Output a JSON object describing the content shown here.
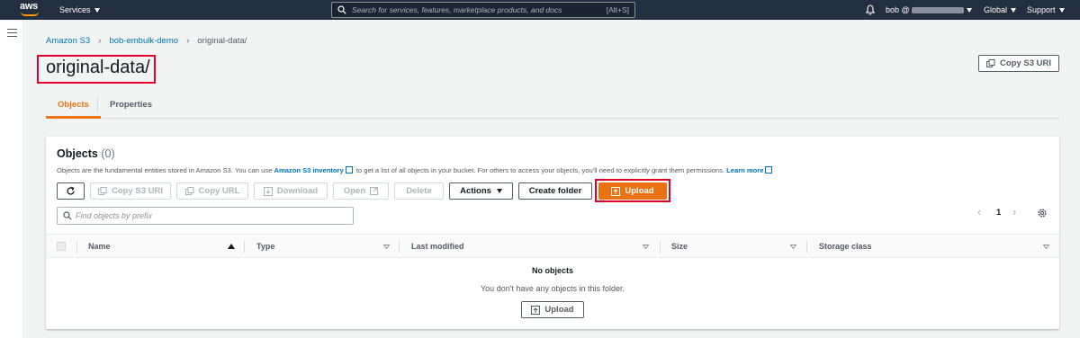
{
  "topnav": {
    "logo_text": "aws",
    "services_label": "Services",
    "search_placeholder": "Search for services, features, marketplace products, and docs",
    "search_shortcut": "[Alt+S]",
    "user_label": "bob @",
    "region_label": "Global",
    "support_label": "Support"
  },
  "breadcrumb": {
    "items": [
      "Amazon S3",
      "bob-embulk-demo",
      "original-data/"
    ]
  },
  "page": {
    "title": "original-data/",
    "copy_uri_label": "Copy S3 URI"
  },
  "tabs": [
    {
      "label": "Objects",
      "active": true
    },
    {
      "label": "Properties",
      "active": false
    }
  ],
  "objects_panel": {
    "title": "Objects",
    "count": "(0)",
    "desc_before": "Objects are the fundamental entities stored in Amazon S3. You can use ",
    "desc_link": "Amazon S3 inventory",
    "desc_after": " to get a list of all objects in your bucket. For others to access your objects, you'll need to explicitly grant them permissions. ",
    "learn_more": "Learn more",
    "toolbar": {
      "copy_uri": "Copy S3 URI",
      "copy_url": "Copy URL",
      "download": "Download",
      "open": "Open",
      "delete": "Delete",
      "actions": "Actions",
      "create_folder": "Create folder",
      "upload": "Upload"
    },
    "find_placeholder": "Find objects by prefix",
    "pagination": {
      "current_page": "1"
    },
    "columns": [
      "Name",
      "Type",
      "Last modified",
      "Size",
      "Storage class"
    ],
    "empty_title": "No objects",
    "empty_desc": "You don't have any objects in this folder.",
    "empty_upload": "Upload"
  },
  "colors": {
    "nav_bg": "#232f3e",
    "accent_orange": "#ec7211",
    "link_blue": "#0073bb",
    "highlight_red": "#e4002b"
  }
}
